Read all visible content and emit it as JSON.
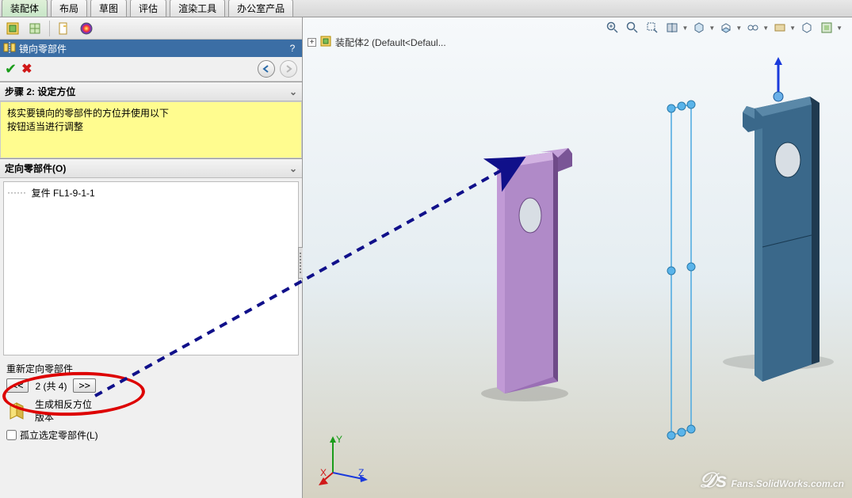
{
  "tabs": [
    "装配体",
    "布局",
    "草图",
    "评估",
    "渲染工具",
    "办公室产品"
  ],
  "active_tab": 0,
  "command": {
    "title": "镜向零部件",
    "help": "?"
  },
  "step": {
    "header": "步骤 2: 设定方位",
    "msg_line1": "核实要镜向的零部件的方位并使用以下",
    "msg_line2": "按钮适当进行调整"
  },
  "orient": {
    "header": "定向零部件(O)",
    "items": [
      "复件 FL1-9-1-1"
    ]
  },
  "reorient": {
    "label": "重新定向零部件",
    "prev": "<<",
    "next": ">>",
    "pos": "2 (共 4)"
  },
  "opposite": {
    "line1": "生成相反方位",
    "line2": "版本"
  },
  "isolate": {
    "label": "孤立选定零部件(L)"
  },
  "tree": {
    "node": "装配体2  (Default<Defaul..."
  },
  "watermark": "Fans.SolidWorks.com.cn"
}
